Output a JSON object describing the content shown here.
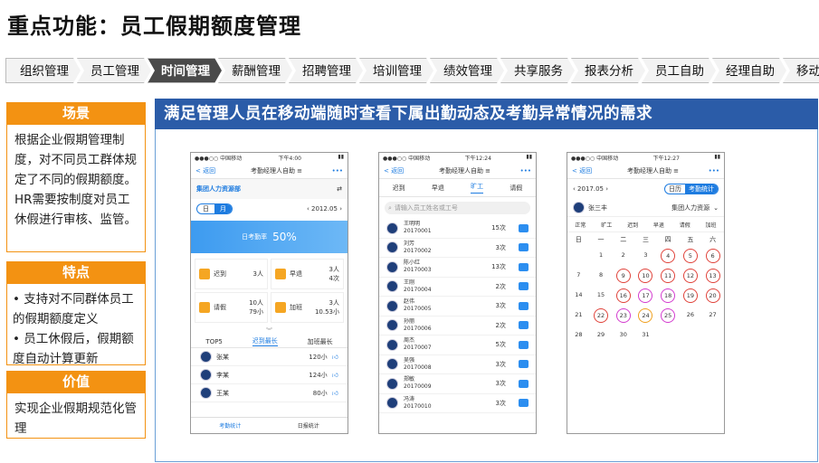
{
  "title": "重点功能：员工假期额度管理",
  "nav": [
    "组织管理",
    "员工管理",
    "时间管理",
    "薪酬管理",
    "招聘管理",
    "培训管理",
    "绩效管理",
    "共享服务",
    "报表分析",
    "员工自助",
    "经理自助",
    "移动应用"
  ],
  "nav_active": 2,
  "sections": [
    {
      "head": "场景",
      "lines": [
        "根据企业假期管理制度，对不同员工群体规定了不同的假期额度。HR需要按制度对员工休假进行审核、监管。"
      ]
    },
    {
      "head": "特点",
      "lines": [
        "• 支持对不同群体员工的假期额度定义",
        "• 员工休假后，假期额度自动计算更新"
      ]
    },
    {
      "head": "价值",
      "lines": [
        "实现企业假期规范化管理"
      ]
    }
  ],
  "banner": "满足管理人员在移动端随时查看下属出勤动态及考勤异常情况的需求",
  "phone1": {
    "status_time": "下午4:00",
    "back": "< 返回",
    "title": "考勤经理人自助 ≡",
    "more": "•••",
    "org": "集团人力资源部",
    "toggle": [
      "日",
      "月"
    ],
    "month": "2012.05",
    "rate_label": "日考勤率",
    "rate_value": "50%",
    "stats": [
      {
        "l": "迟到",
        "v1": "3人",
        "v2": ""
      },
      {
        "l": "早退",
        "v1": "3人",
        "v2": "4次"
      },
      {
        "l": "请假",
        "v1": "10人",
        "v2": "79小"
      },
      {
        "l": "加班",
        "v1": "3人",
        "v2": "10.53小"
      }
    ],
    "tabs": [
      "TOP5",
      "迟到最长",
      "加班最长"
    ],
    "rank": [
      {
        "n": "张某",
        "v": "120小"
      },
      {
        "n": "李某",
        "v": "124小"
      },
      {
        "n": "王某",
        "v": "80小"
      }
    ],
    "bottom": [
      "考勤统计",
      "日报统计"
    ]
  },
  "phone2": {
    "status_time": "下午12:24",
    "back": "< 返回",
    "title": "考勤经理人自助 ≡",
    "more": "•••",
    "tabs": [
      "迟到",
      "早退",
      "旷工",
      "请假"
    ],
    "search": "请输入员工姓名或工号",
    "list": [
      {
        "n": "王明明",
        "id": "20170001",
        "c": "15次"
      },
      {
        "n": "刘芳",
        "id": "20170002",
        "c": "3次"
      },
      {
        "n": "陈小红",
        "id": "20170003",
        "c": "13次"
      },
      {
        "n": "王刚",
        "id": "20170004",
        "c": "2次"
      },
      {
        "n": "赵伟",
        "id": "20170005",
        "c": "3次"
      },
      {
        "n": "孙丽",
        "id": "20170006",
        "c": "2次"
      },
      {
        "n": "周杰",
        "id": "20170007",
        "c": "5次"
      },
      {
        "n": "吴强",
        "id": "20170008",
        "c": "3次"
      },
      {
        "n": "郑敏",
        "id": "20170009",
        "c": "3次"
      },
      {
        "n": "冯涛",
        "id": "20170010",
        "c": "3次"
      }
    ]
  },
  "phone3": {
    "status_time": "下午12:27",
    "back": "< 返回",
    "title": "考勤经理人自助 ≡",
    "more": "•••",
    "month": "2017.05",
    "mode": [
      "日历",
      "考勤统计"
    ],
    "person": "张三丰",
    "dept": "集团人力资源",
    "legend": [
      "正常",
      "旷工",
      "迟到",
      "早退",
      "请假",
      "加班"
    ],
    "weekdays": [
      "日",
      "一",
      "二",
      "三",
      "四",
      "五",
      "六"
    ],
    "weeks": [
      [
        "",
        "1",
        "2",
        "3",
        "4",
        "5",
        "6"
      ],
      [
        "7",
        "8",
        "9",
        "10",
        "11",
        "12",
        "13"
      ],
      [
        "14",
        "15",
        "16",
        "17",
        "18",
        "19",
        "20"
      ],
      [
        "21",
        "22",
        "23",
        "24",
        "25",
        "26",
        "27"
      ],
      [
        "28",
        "29",
        "30",
        "31",
        "",
        "",
        ""
      ]
    ]
  },
  "colors": {
    "accent": "#f39212",
    "banner": "#2b5ca8",
    "app_blue": "#1e7ce0",
    "ring_red": "#e0423a"
  }
}
